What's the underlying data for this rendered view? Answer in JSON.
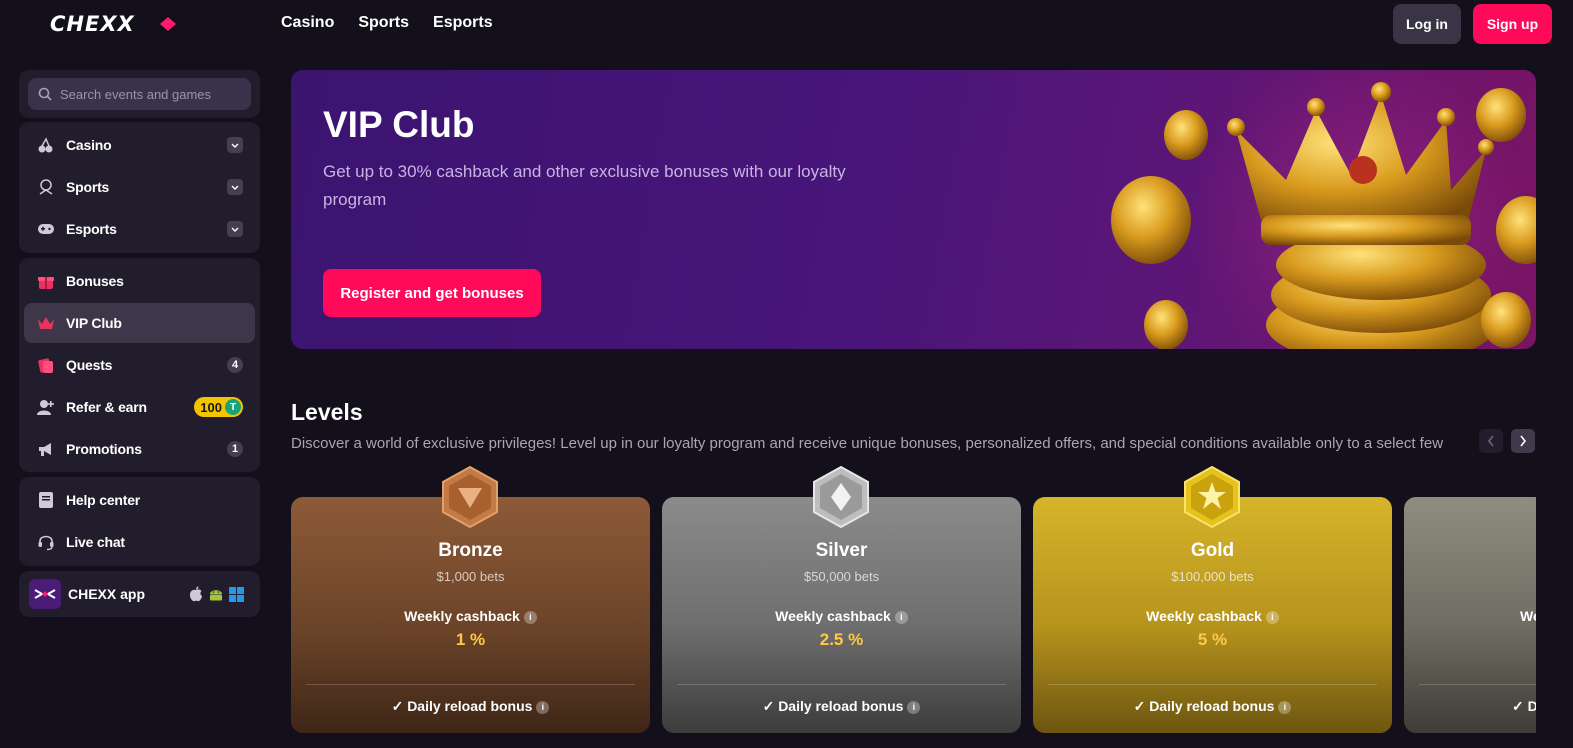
{
  "header": {
    "logo": "CHEXX",
    "nav": [
      "Casino",
      "Sports",
      "Esports"
    ],
    "login_label": "Log in",
    "signup_label": "Sign up"
  },
  "sidebar": {
    "search_placeholder": "Search events and games",
    "sports_group": [
      {
        "label": "Casino",
        "icon": "casino-icon"
      },
      {
        "label": "Sports",
        "icon": "sports-icon"
      },
      {
        "label": "Esports",
        "icon": "gamepad-icon"
      }
    ],
    "bonus_group": [
      {
        "label": "Bonuses",
        "icon": "gift-icon"
      },
      {
        "label": "VIP Club",
        "icon": "crown-icon",
        "active": true
      },
      {
        "label": "Quests",
        "icon": "quests-icon",
        "count": "4"
      },
      {
        "label": "Refer & earn",
        "icon": "refer-icon",
        "badge": "100",
        "badge_coin": "T"
      },
      {
        "label": "Promotions",
        "icon": "megaphone-icon",
        "count": "1"
      }
    ],
    "help_group": [
      {
        "label": "Help center",
        "icon": "book-icon"
      },
      {
        "label": "Live chat",
        "icon": "headset-icon"
      }
    ],
    "app_label": "CHEXX app",
    "app_platforms": [
      "apple-icon",
      "android-icon",
      "windows-icon"
    ]
  },
  "hero": {
    "title": "VIP Club",
    "subtitle": "Get up to 30% cashback and other exclusive bonuses with our loyalty program",
    "button": "Register and get bonuses"
  },
  "levels": {
    "title": "Levels",
    "description": "Discover a world of exclusive privileges! Level up in our loyalty program and receive unique bonuses, personalized offers, and special conditions available only to a select few",
    "cards": [
      {
        "name": "Bronze",
        "bets": "$1,000 bets",
        "cashback_label": "Weekly cashback",
        "cashback_value": "1 %",
        "perk": "Daily reload bonus"
      },
      {
        "name": "Silver",
        "bets": "$50,000 bets",
        "cashback_label": "Weekly cashback",
        "cashback_value": "2.5 %",
        "perk": "Daily reload bonus"
      },
      {
        "name": "Gold",
        "bets": "$100,000 bets",
        "cashback_label": "Weekly cashback",
        "cashback_value": "5 %",
        "perk": "Daily reload bonus"
      },
      {
        "name": "",
        "bets": "",
        "cashback_label": "Weekly cashback",
        "cashback_value": "",
        "perk": "Daily reload bonus"
      }
    ]
  },
  "colors": {
    "accent": "#ff0a5a",
    "background": "#130f1b",
    "panel": "#221d2c",
    "cashback_value": "#ffc947"
  }
}
